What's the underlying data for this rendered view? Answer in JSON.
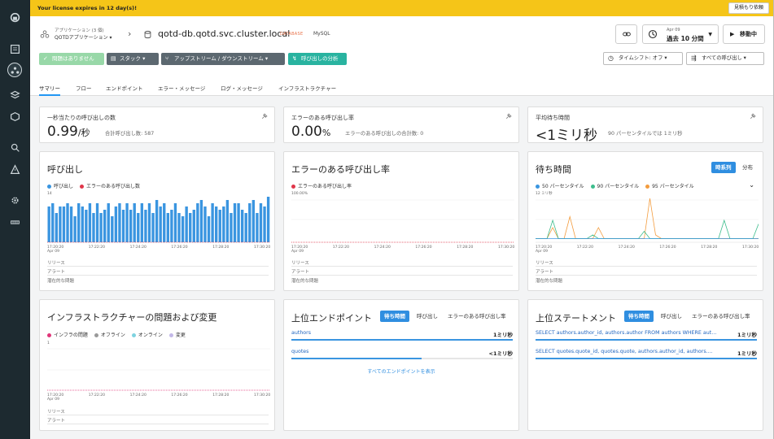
{
  "banner": {
    "text": "Your license expires in 12 day(s)!",
    "button": "見積もり依頼"
  },
  "header": {
    "app_line1": "アプリケーション (3 個)",
    "app_line2": "QOTDアプリケーション ▾",
    "db_name": "qotd-db.qotd.svc.cluster.local",
    "db_tag": "DATABASE",
    "db_type": "MySQL",
    "time_label_small": "Apr 09",
    "time_label": "過去 10 分間",
    "pause_label": "移動中",
    "status_ok": "問題はありません",
    "stack": "スタック ▾",
    "upstream": "アップストリーム / ダウンストリーム ▾",
    "analyze": "呼び出しの分析",
    "timeshift": "タイムシフト: オフ ▾",
    "all_calls": "すべての呼び出し ▾"
  },
  "tabs": [
    "サマリー",
    "フロー",
    "エンドポイント",
    "エラー・メッセージ",
    "ログ・メッセージ",
    "インフラストラクチャー"
  ],
  "kpi": {
    "calls": {
      "title": "一秒当たりの呼び出しの数",
      "value": "0.99",
      "unit": "/秒",
      "sub": "合計呼び出し数: 587"
    },
    "errors": {
      "title": "エラーのある呼び出し率",
      "value": "0.00",
      "unit": "%",
      "sub": "エラーのある呼び出しの合計数: 0"
    },
    "latency": {
      "title": "平均待ち時間",
      "value": "<1ミリ秒",
      "sub": "90 パーセンタイルでは 1ミリ秒"
    }
  },
  "calls_chart": {
    "title": "呼び出し",
    "legend": [
      "呼び出し",
      "エラーのある呼び出し数"
    ],
    "ymax_label": "14",
    "xticks": [
      "17:20:20",
      "17:22:20",
      "17:24:20",
      "17:26:20",
      "17:28:20",
      "17:30:20"
    ],
    "xsub": "Apr 09",
    "rows": [
      "リリース",
      "アラート",
      "潜在的な問題"
    ]
  },
  "error_chart": {
    "title": "エラーのある呼び出し率",
    "legend": [
      "エラーのある呼び出し率"
    ],
    "ymax_label": "100.00%",
    "xticks": [
      "17:20:20",
      "17:22:20",
      "17:24:20",
      "17:26:20",
      "17:28:20",
      "17:30:20"
    ],
    "xsub": "Apr 09",
    "rows": [
      "リリース",
      "アラート",
      "潜在的な問題"
    ]
  },
  "latency_chart": {
    "title": "待ち時間",
    "toggle_on": "時系列",
    "toggle_off": "分布",
    "legend": [
      "50 パーセンタイル",
      "90 パーセンタイル",
      "95 パーセンタイル"
    ],
    "ymax_label": "12 ミリ秒",
    "xticks": [
      "17:20:20",
      "17:22:20",
      "17:24:20",
      "17:26:20",
      "17:28:20",
      "17:30:20"
    ],
    "xsub": "Apr 09",
    "rows": [
      "リリース",
      "アラート",
      "潜在的な問題"
    ]
  },
  "infra_chart": {
    "title": "インフラストラクチャーの問題および変更",
    "legend": [
      "インフラの問題",
      "オフライン",
      "オンライン",
      "変更"
    ],
    "ymax_label": "1",
    "xticks": [
      "17:20:20",
      "17:22:20",
      "17:24:20",
      "17:26:20",
      "17:28:20",
      "17:30:20"
    ],
    "xsub": "Apr 09",
    "rows": [
      "リリース",
      "アラート"
    ]
  },
  "top_endpoints": {
    "title": "上位エンドポイント",
    "toggles": [
      "待ち時間",
      "呼び出し",
      "エラーのある呼び出し率"
    ],
    "items": [
      {
        "name": "authors",
        "value": "1ミリ秒",
        "fill": 1.0
      },
      {
        "name": "quotes",
        "value": "<1ミリ秒",
        "fill": 0.59
      }
    ],
    "show_all": "すべてのエンドポイントを表示"
  },
  "top_statements": {
    "title": "上位ステートメント",
    "toggles": [
      "待ち時間",
      "呼び出し",
      "エラーのある呼び出し率"
    ],
    "items": [
      {
        "name": "SELECT authors.author_id, authors.author FROM authors WHERE auth...",
        "value": "1ミリ秒",
        "fill": 1.0
      },
      {
        "name": "SELECT quotes.quote_id, quotes.quote, authors.author_id, authors....",
        "value": "1ミリ秒",
        "fill": 1.0
      }
    ]
  },
  "chart_data": [
    {
      "type": "bar",
      "title": "呼び出し",
      "ylim": [
        0,
        14
      ],
      "series": [
        {
          "name": "呼び出し",
          "color": "#3a95e0",
          "values": [
            11,
            12,
            9,
            11,
            11,
            12,
            11,
            8,
            12,
            11,
            10,
            12,
            9,
            12,
            9,
            10,
            12,
            8,
            11,
            12,
            10,
            12,
            10,
            12,
            9,
            12,
            10,
            12,
            9,
            13,
            11,
            12,
            9,
            10,
            12,
            9,
            8,
            11,
            9,
            10,
            12,
            13,
            11,
            8,
            12,
            11,
            10,
            11,
            13,
            9,
            12,
            12,
            10,
            9,
            12,
            13,
            9,
            12,
            11,
            14
          ]
        },
        {
          "name": "エラーのある呼び出し数",
          "color": "#e0364a",
          "values": []
        }
      ]
    },
    {
      "type": "line",
      "title": "エラーのある呼び出し率",
      "ylim": [
        0,
        100
      ],
      "series": [
        {
          "name": "エラーのある呼び出し率",
          "color": "#e0364a",
          "values": [
            0,
            0,
            0,
            0,
            0,
            0,
            0,
            0,
            0,
            0
          ]
        }
      ]
    },
    {
      "type": "line",
      "title": "待ち時間",
      "ylim": [
        0,
        12
      ],
      "series": [
        {
          "name": "50 パーセンタイル",
          "color": "#3a95e0",
          "values": [
            1,
            1,
            1,
            1,
            1,
            1,
            1,
            1,
            1,
            1,
            1,
            1,
            1,
            1,
            1,
            1,
            1,
            1,
            1,
            1,
            1,
            1,
            1,
            1,
            1,
            1,
            1,
            1,
            1,
            1,
            1,
            1,
            1,
            1,
            1,
            1,
            1,
            1,
            1,
            1
          ]
        },
        {
          "name": "90 パーセンタイル",
          "color": "#3dbd8c",
          "values": [
            1,
            1,
            1,
            6,
            1,
            1,
            1,
            1,
            1,
            1,
            2,
            1,
            1,
            1,
            1,
            1,
            1,
            1,
            1,
            3,
            1,
            1,
            1,
            1,
            1,
            1,
            1,
            1,
            1,
            1,
            1,
            1,
            1,
            6,
            1,
            1,
            1,
            1,
            1,
            5
          ]
        },
        {
          "name": "95 パーセンタイル",
          "color": "#f39c3e",
          "values": [
            1,
            1,
            1,
            4,
            1,
            1,
            7,
            1,
            1,
            1,
            1,
            4,
            1,
            1,
            1,
            1,
            1,
            1,
            1,
            1,
            12,
            2,
            1,
            1,
            1,
            1,
            1,
            1,
            1,
            1,
            1,
            1,
            1,
            1,
            1,
            1,
            1,
            1,
            1,
            1
          ]
        }
      ]
    }
  ]
}
